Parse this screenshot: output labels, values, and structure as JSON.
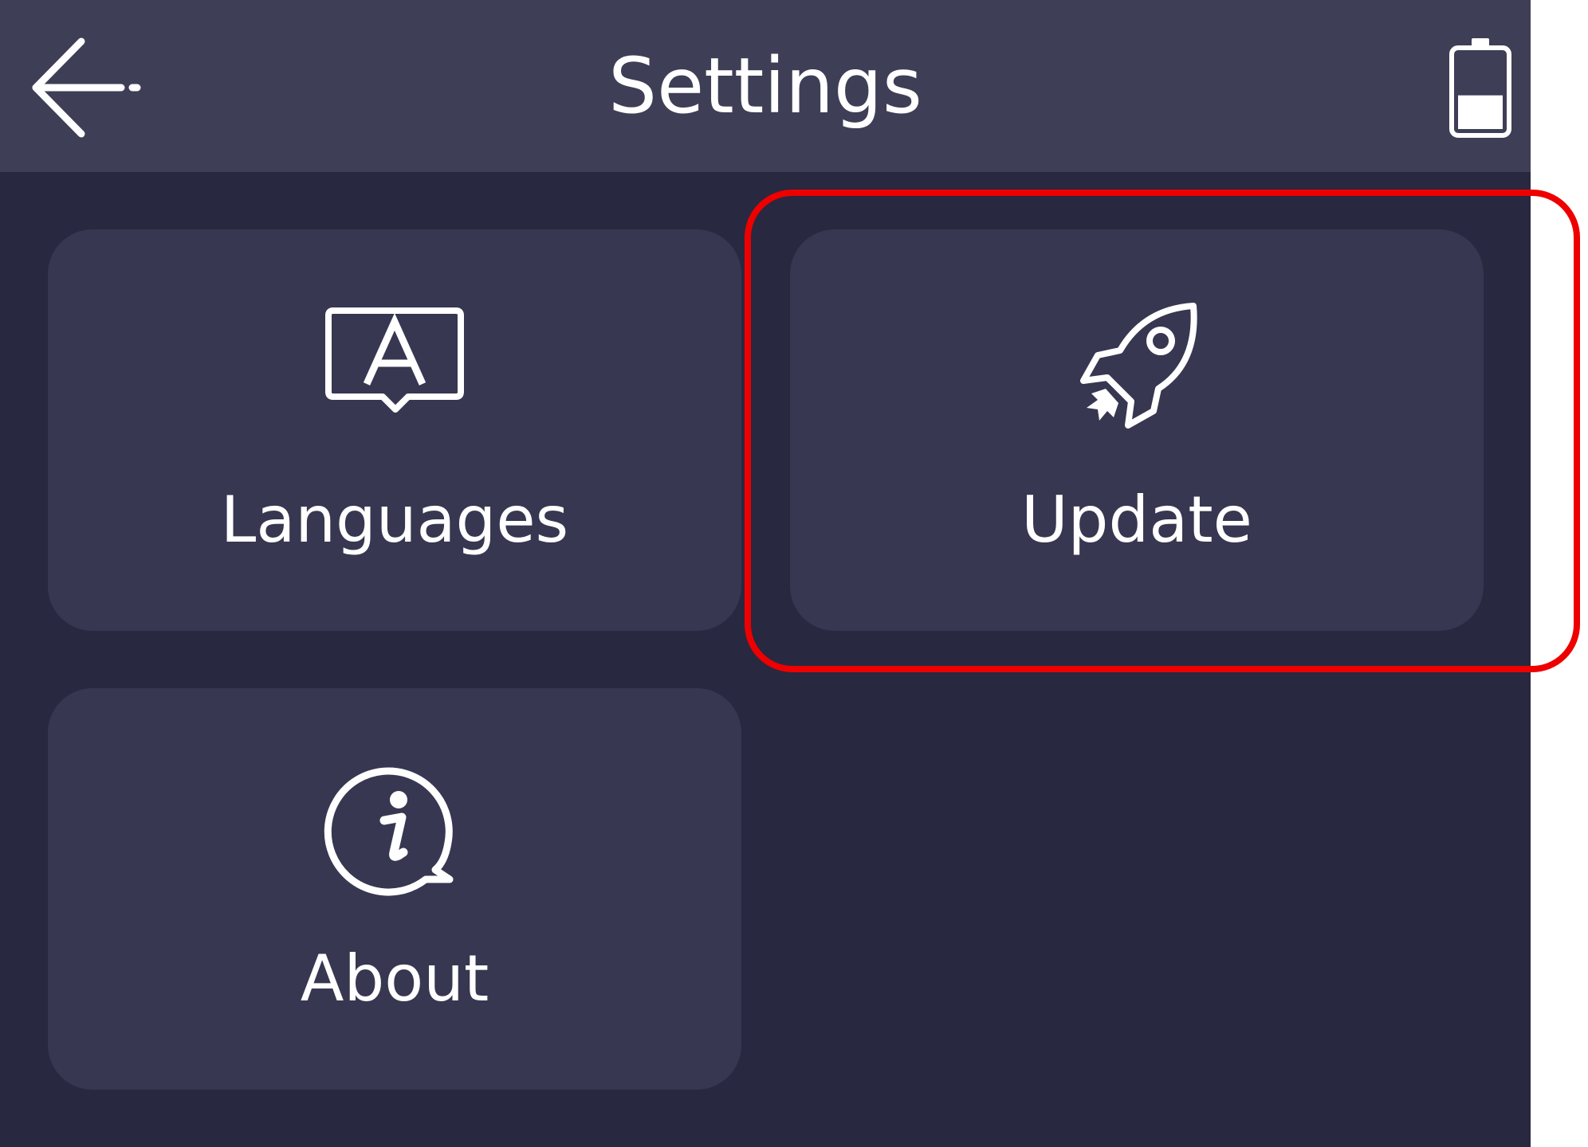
{
  "header": {
    "title": "Settings",
    "back_icon": "back-arrow-icon",
    "battery_icon": "battery-icon",
    "battery_level": 0.45
  },
  "tiles": [
    {
      "label": "Languages",
      "icon": "language-icon"
    },
    {
      "label": "Update",
      "icon": "rocket-icon",
      "highlighted": true
    },
    {
      "label": "About",
      "icon": "info-icon"
    }
  ],
  "colors": {
    "background": "#282840",
    "header": "#3e3e56",
    "tile": "#373752",
    "text": "#ffffff",
    "highlight": "#ee0000"
  }
}
